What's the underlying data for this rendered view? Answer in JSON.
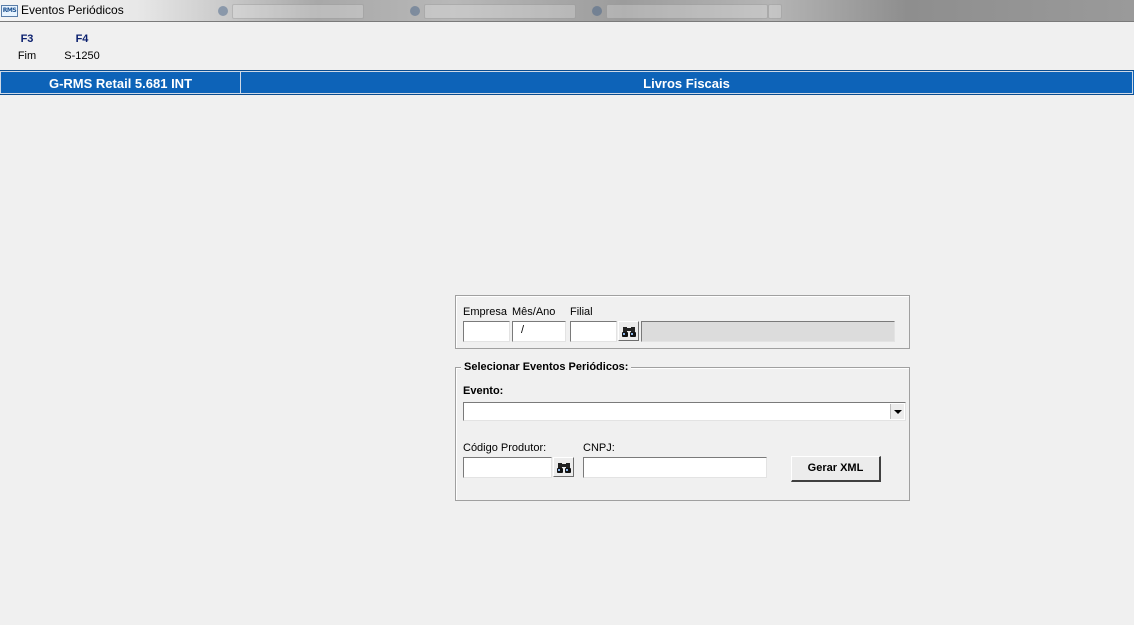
{
  "window": {
    "title": "Eventos Periódicos",
    "icon_text": "RMS"
  },
  "function_keys": [
    {
      "key": "F3",
      "label": "Fim"
    },
    {
      "key": "F4",
      "label": "S-1250"
    }
  ],
  "header_bar": {
    "app_version": "G-RMS Retail 5.681 INT",
    "module_title": "Livros Fiscais"
  },
  "filter_group": {
    "empresa_label": "Empresa",
    "mes_ano_label": "Mês/Ano",
    "filial_label": "Filial",
    "empresa_value": "",
    "mes_ano_value": "/",
    "filial_value": "",
    "filial_description": ""
  },
  "eventos_group": {
    "legend": "Selecionar Eventos Periódicos:",
    "evento_label": "Evento:",
    "evento_selected": "",
    "codigo_produtor_label": "Código Produtor:",
    "codigo_produtor_value": "",
    "cnpj_label": "CNPJ:",
    "cnpj_value": "",
    "gerar_xml_label": "Gerar XML"
  },
  "colors": {
    "header_bar": "#0d63b8",
    "function_key": "#0a1f6e",
    "background": "#f0f0f0"
  }
}
